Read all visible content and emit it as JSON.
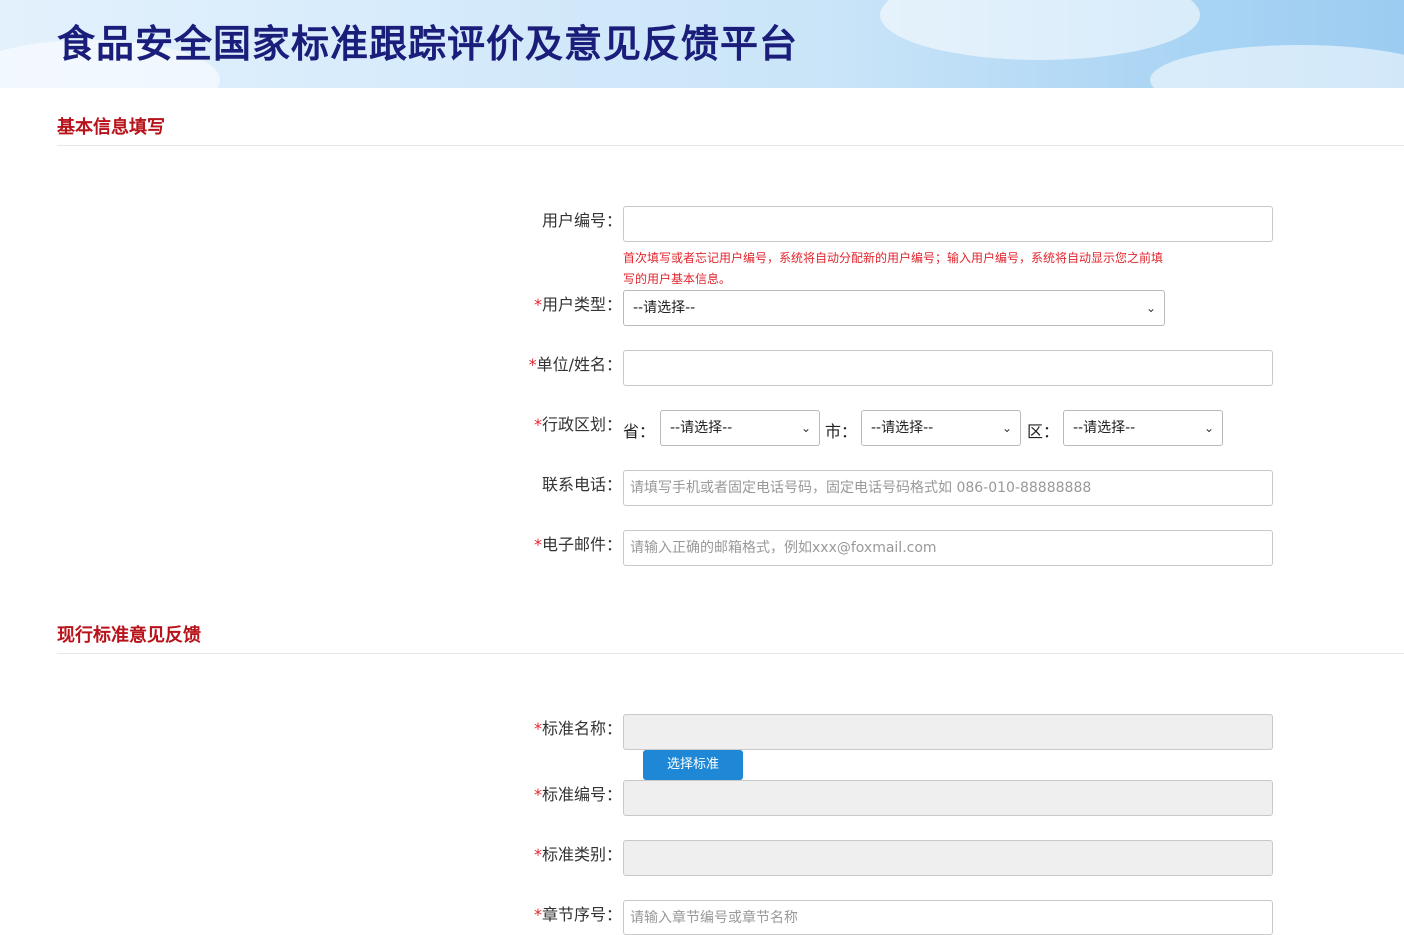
{
  "header": {
    "title": "食品安全国家标准跟踪评价及意见反馈平台"
  },
  "sections": {
    "basic_info": "基本信息填写",
    "feedback": "现行标准意见反馈"
  },
  "form": {
    "user_id": {
      "label": "用户编号：",
      "value": "",
      "hint": "首次填写或者忘记用户编号，系统将自动分配新的用户编号；输入用户编号，系统将自动显示您之前填写的用户基本信息。"
    },
    "user_type": {
      "label": "用户类型：",
      "selected": "--请选择--"
    },
    "org_name": {
      "label": "单位/姓名：",
      "value": ""
    },
    "region": {
      "label": "行政区划：",
      "province_label": "省：",
      "province_selected": "--请选择--",
      "city_label": "市：",
      "city_selected": "--请选择--",
      "district_label": "区：",
      "district_selected": "--请选择--"
    },
    "phone": {
      "label": "联系电话：",
      "placeholder": "请填写手机或者固定电话号码，固定电话号码格式如 086-010-88888888"
    },
    "email": {
      "label": "电子邮件：",
      "placeholder": "请输入正确的邮箱格式，例如xxx@foxmail.com"
    }
  },
  "standard": {
    "name": {
      "label": "标准名称：",
      "value": ""
    },
    "select_button": "选择标准",
    "number": {
      "label": "标准编号：",
      "value": ""
    },
    "category": {
      "label": "标准类别：",
      "value": ""
    },
    "chapter": {
      "label": "章节序号：",
      "placeholder": "请输入章节编号或章节名称"
    }
  },
  "required_mark": "*",
  "colors": {
    "title": "#1b1d7a",
    "section": "#b8121a",
    "required": "#e0262e",
    "button": "#1e88d6"
  }
}
